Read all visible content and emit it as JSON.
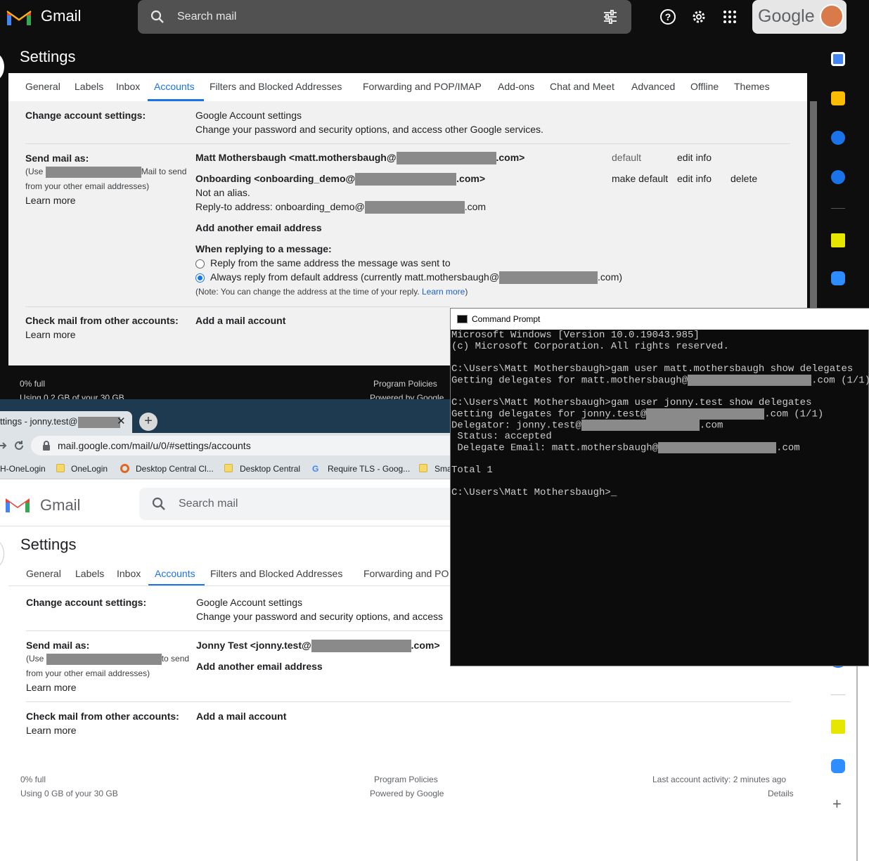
{
  "dark": {
    "app_name": "Gmail",
    "search_placeholder": "Search mail",
    "google_word": "Google",
    "settings_title": "Settings",
    "tabs": [
      "General",
      "Labels",
      "Inbox",
      "Accounts",
      "Filters and Blocked Addresses",
      "Forwarding and POP/IMAP",
      "Add-ons",
      "Chat and Meet",
      "Advanced",
      "Offline",
      "Themes"
    ],
    "change_account": {
      "label": "Change account settings:",
      "link": "Google Account settings",
      "desc": "Change your password and security options, and access other Google services."
    },
    "send_mail": {
      "label": "Send mail as:",
      "help_pre": "(Use",
      "help_mid": "Mail to send",
      "help_post": "from your other email addresses)",
      "learn_more": "Learn more",
      "acct1_pre": "Matt Mothersbaugh <matt.mothersbaugh@",
      "acct1_post": ".com>",
      "acct1_status": "default",
      "acct1_edit": "edit info",
      "acct2_pre": "Onboarding <onboarding_demo@",
      "acct2_post": ".com>",
      "acct2_note": "Not an alias.",
      "acct2_reply_pre": "Reply-to address: onboarding_demo@",
      "acct2_reply_post": ".com",
      "acct2_make_default": "make default",
      "acct2_edit": "edit info",
      "acct2_delete": "delete",
      "add_another": "Add another email address",
      "when_replying": "When replying to a message:",
      "reply_opt1": "Reply from the same address the message was sent to",
      "reply_opt2_pre": "Always reply from default address (currently matt.mothersbaugh@",
      "reply_opt2_post": ".com)",
      "note_pre": "(Note: You can change the address at the time of your reply.",
      "note_link": "Learn more",
      "note_post": ")"
    },
    "check_mail": {
      "label": "Check mail from other accounts:",
      "link": "Add a mail account",
      "learn_more": "Learn more"
    },
    "footer": {
      "full": "0% full",
      "usage": "Using 0.2 GB of your 30 GB",
      "policies": "Program Policies",
      "powered": "Powered by Google"
    }
  },
  "chrome": {
    "tab_title": "ttings - jonny.test@",
    "tab_close": "✕",
    "new_tab": "+",
    "url": "mail.google.com/mail/u/0/#settings/accounts",
    "bookmarks": [
      "H-OneLogin",
      "OneLogin",
      "Desktop Central Cl...",
      "Desktop Central",
      "Require TLS - Goog...",
      "Sma"
    ]
  },
  "light": {
    "app_name": "Gmail",
    "search_placeholder": "Search mail",
    "settings_title": "Settings",
    "tabs": [
      "General",
      "Labels",
      "Inbox",
      "Accounts",
      "Filters and Blocked Addresses",
      "Forwarding and PO"
    ],
    "change_account": {
      "label": "Change account settings:",
      "link": "Google Account settings",
      "desc": "Change your password and security options, and access"
    },
    "send_mail": {
      "label": "Send mail as:",
      "help_pre": "(Use",
      "help_mid": "to send",
      "help_post": "from your other email addresses)",
      "learn_more": "Learn more",
      "acct1_pre": "Jonny Test <jonny.test@",
      "acct1_post": ".com>",
      "add_another": "Add another email address"
    },
    "check_mail": {
      "label": "Check mail from other accounts:",
      "link": "Add a mail account",
      "learn_more": "Learn more"
    },
    "footer": {
      "full": "0% full",
      "usage": "Using 0 GB of your 30 GB",
      "policies": "Program Policies",
      "powered": "Powered by Google",
      "activity": "Last account activity: 2 minutes ago",
      "details": "Details"
    }
  },
  "cmd": {
    "title": "Command Prompt",
    "lines": [
      "Microsoft Windows [Version 10.0.19043.985]",
      "(c) Microsoft Corporation. All rights reserved.",
      "",
      "C:\\Users\\Matt Mothersbaugh>gam user matt.mothersbaugh show delegates",
      "Getting delegates for matt.mothersbaugh@",
      "",
      "C:\\Users\\Matt Mothersbaugh>gam user jonny.test show delegates",
      "Getting delegates for jonny.test@",
      "Delegator: jonny.test@",
      " Status: accepted",
      " Delegate Email: matt.mothersbaugh@",
      "",
      "Total 1",
      "",
      "C:\\Users\\Matt Mothersbaugh>"
    ],
    "suffix_line5": ".com (1/1)",
    "suffix_line8": ".com (1/1)",
    "suffix_line9": ".com",
    "suffix_line11": ".com",
    "cursor": "_"
  },
  "colors": {
    "link": "#1a5fd0",
    "active_tab": "#1a73e8",
    "redaction": "#8a8a8a",
    "gmail_red": "#ea4335"
  }
}
